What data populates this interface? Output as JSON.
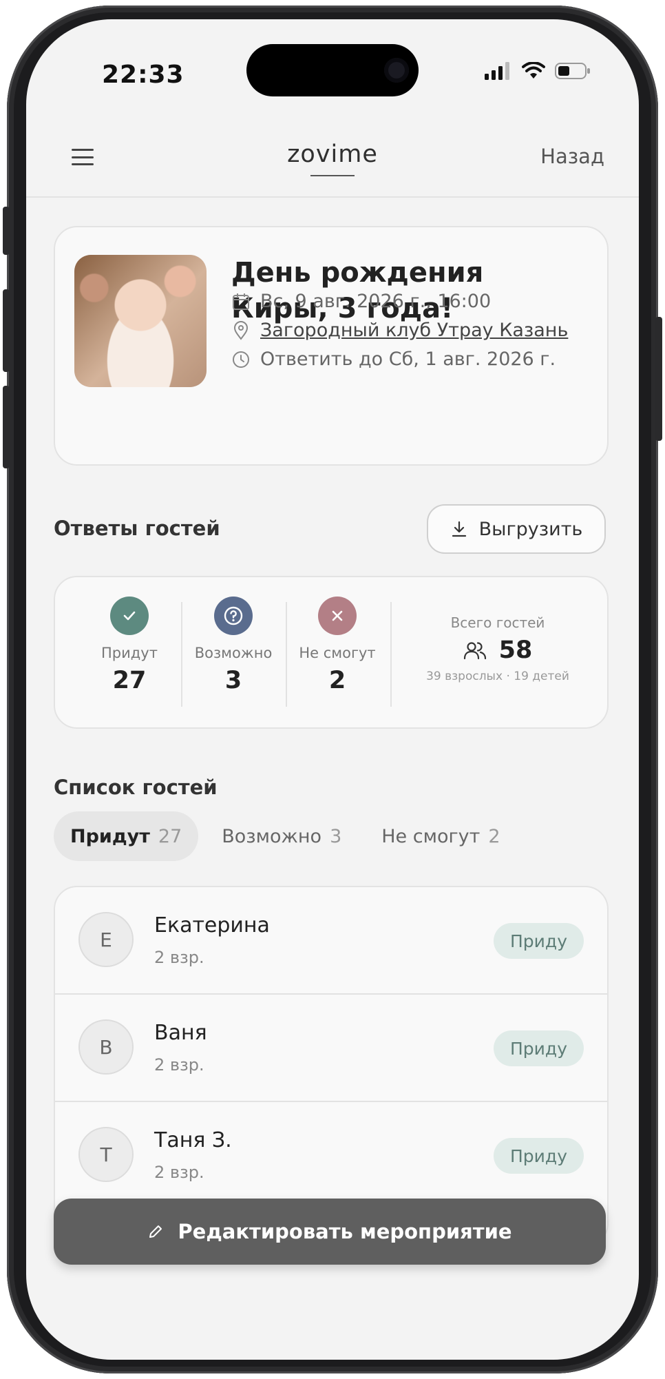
{
  "status_bar": {
    "time": "22:33"
  },
  "header": {
    "logo": "zovime",
    "back_label": "Назад"
  },
  "event": {
    "title": "День рождения Киры, 3 года!",
    "date": "Вс, 9 авг. 2026 г., 16:00",
    "venue": "Загородный клуб Утрау Казань",
    "rsvp_deadline": "Ответить до Сб, 1 авг. 2026 г."
  },
  "responses": {
    "title": "Ответы гостей",
    "export_label": "Выгрузить",
    "stats": [
      {
        "label": "Придут",
        "value": "27",
        "color": "#5d8a80",
        "icon": "check-icon"
      },
      {
        "label": "Возможно",
        "value": "3",
        "color": "#5a6c8e",
        "icon": "question-icon"
      },
      {
        "label": "Не смогут",
        "value": "2",
        "color": "#b37f86",
        "icon": "x-icon"
      }
    ],
    "total": {
      "label": "Всего гостей",
      "value": "58",
      "breakdown": "39 взрослых · 19 детей"
    }
  },
  "guest_list": {
    "title": "Список гостей",
    "tabs": [
      {
        "label": "Придут",
        "count": "27",
        "active": true
      },
      {
        "label": "Возможно",
        "count": "3",
        "active": false
      },
      {
        "label": "Не смогут",
        "count": "2",
        "active": false
      }
    ],
    "guests": [
      {
        "initial": "Е",
        "name": "Екатерина",
        "detail": "2 взр.",
        "status": "Приду"
      },
      {
        "initial": "В",
        "name": "Ваня",
        "detail": "2 взр.",
        "status": "Приду"
      },
      {
        "initial": "Т",
        "name": "Таня З.",
        "detail": "2 взр.",
        "status": "Приду"
      }
    ]
  },
  "footer": {
    "edit_label": "Редактировать мероприятие"
  },
  "colors": {
    "accent_going": "#5d8a80",
    "accent_maybe": "#5a6c8e",
    "accent_not": "#b37f86",
    "button_dark": "#5f5f5f",
    "badge_bg": "#e0ebe8"
  }
}
